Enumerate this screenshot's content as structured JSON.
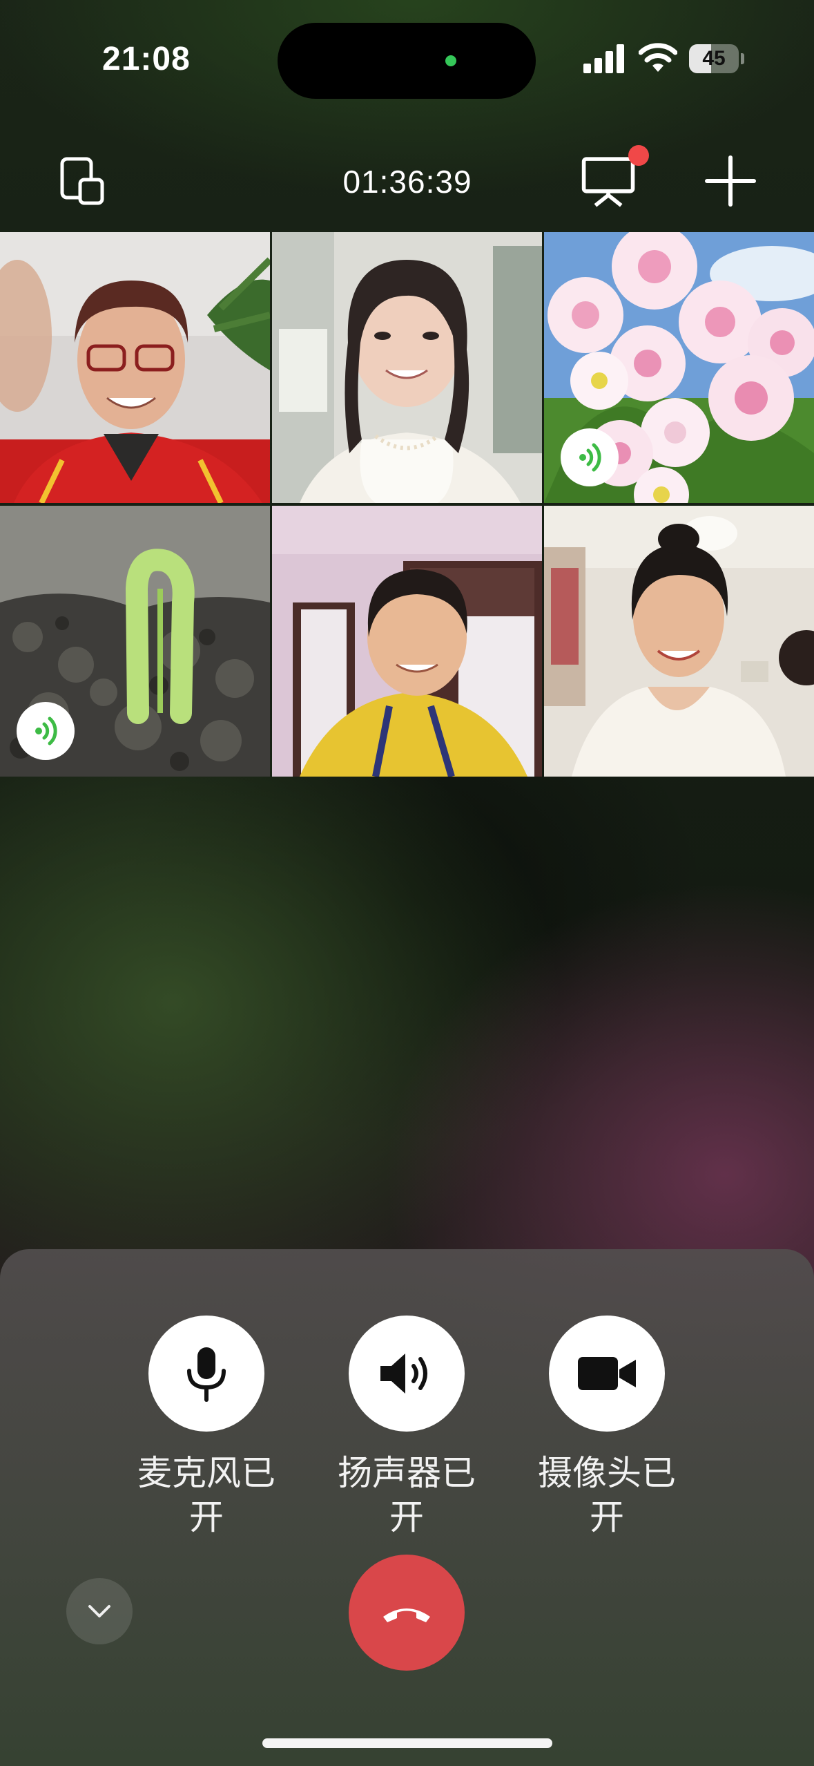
{
  "status_bar": {
    "time": "21:08",
    "battery_level": "45",
    "battery_fraction": 0.45,
    "icons": [
      "signal-icon",
      "wifi-icon",
      "battery-icon"
    ]
  },
  "top_bar": {
    "call_duration": "01:36:39",
    "left_icon": "switch-view-icon",
    "right_icons": [
      "screen-share-icon",
      "add-icon"
    ],
    "notification_dot_color": "#f04848"
  },
  "participants": [
    {
      "tile": 1,
      "speaking_indicator": false
    },
    {
      "tile": 2,
      "speaking_indicator": false
    },
    {
      "tile": 3,
      "speaking_indicator": true
    },
    {
      "tile": 4,
      "speaking_indicator": true
    },
    {
      "tile": 5,
      "speaking_indicator": false
    },
    {
      "tile": 6,
      "speaking_indicator": false
    }
  ],
  "controls": {
    "mic_label": "麦克风已开",
    "speaker_label": "扬声器已开",
    "camera_label": "摄像头已开",
    "hangup_icon": "hang-up-icon",
    "collapse_icon": "chevron-down-icon"
  },
  "colors": {
    "hangup": "#d9474a",
    "speaking_badge": "#3dbb45"
  }
}
